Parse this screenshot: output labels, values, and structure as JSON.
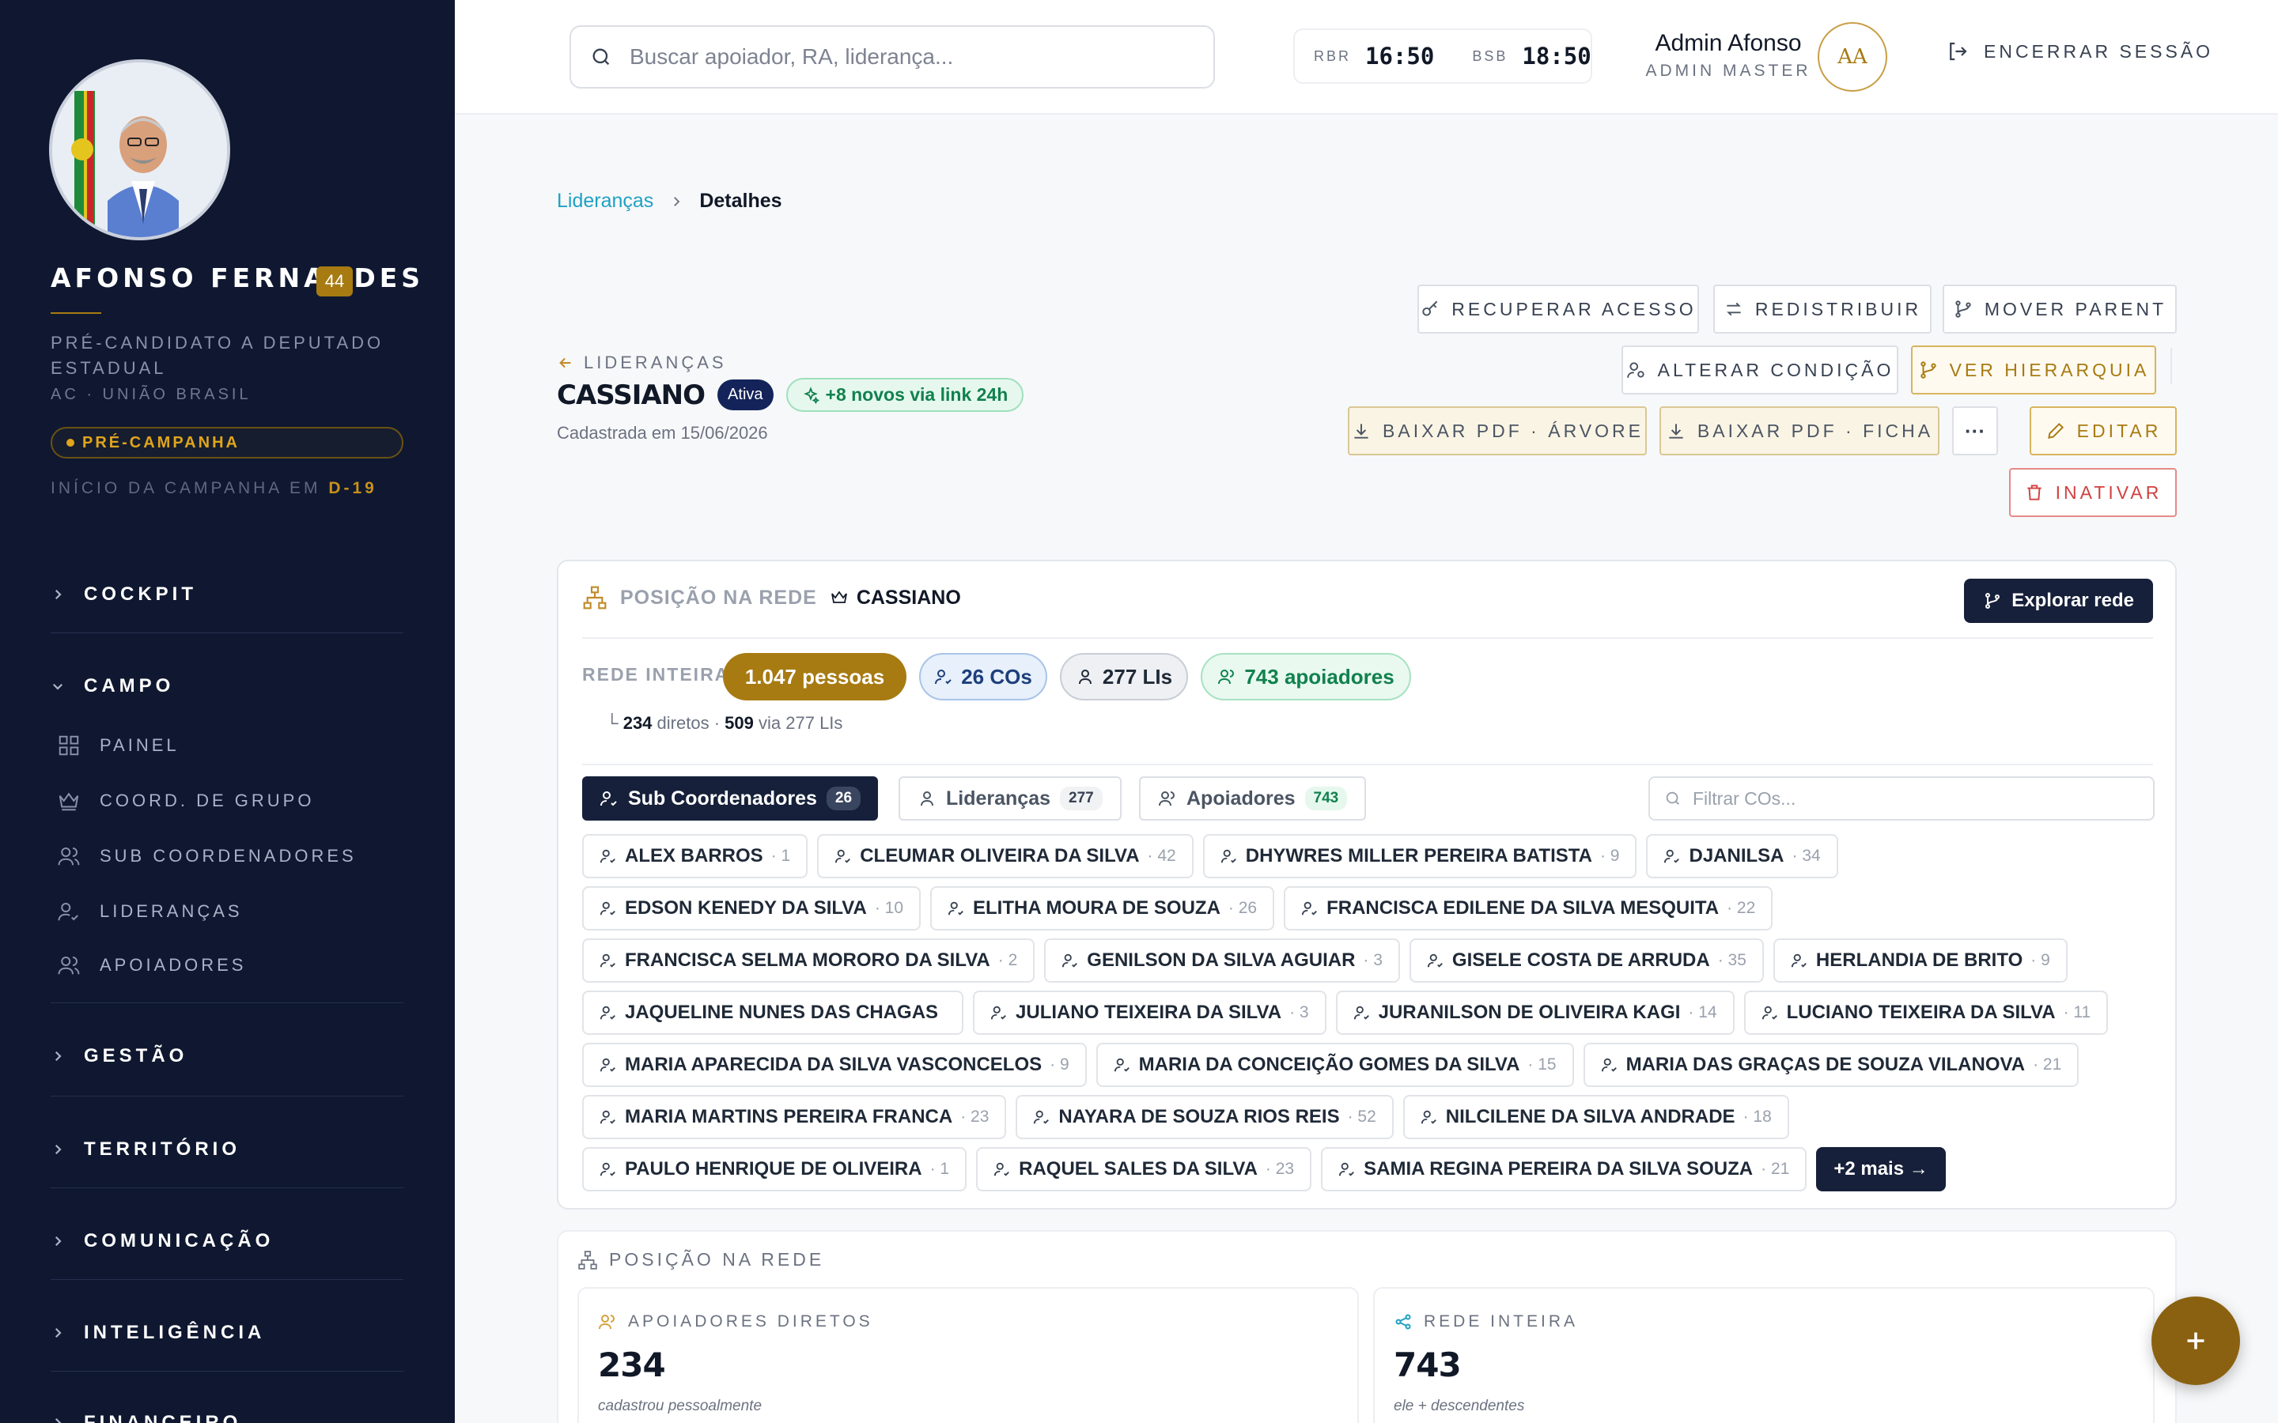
{
  "sidebar": {
    "candidate_name": "AFONSO FERNANDES",
    "candidate_number": "44",
    "candidate_role": "PRÉ-CANDIDATO A DEPUTADO ESTADUAL",
    "candidate_party": "AC · UNIÃO BRASIL",
    "phase_badge": "PRÉ-CAMPANHA",
    "campaign_start_prefix": "INÍCIO DA CAMPANHA EM",
    "campaign_start_value": "D-19",
    "sections": {
      "cockpit": "COCKPIT",
      "campo": "CAMPO",
      "gestao": "GESTÃO",
      "territorio": "TERRITÓRIO",
      "comunicacao": "COMUNICAÇÃO",
      "inteligencia": "INTELIGÊNCIA",
      "financeiro": "FINANCEIRO"
    },
    "campo_items": [
      "PAINEL",
      "COORD. DE GRUPO",
      "SUB COORDENADORES",
      "LIDERANÇAS",
      "APOIADORES"
    ]
  },
  "topbar": {
    "search_placeholder": "Buscar apoiador, RA, liderança...",
    "clock1_city": "RBR",
    "clock1_time": "16:50",
    "clock2_city": "BSB",
    "clock2_time": "18:50",
    "user_name": "Admin Afonso",
    "user_role": "ADMIN MASTER",
    "user_initials": "AA",
    "logout_label": "ENCERRAR SESSÃO"
  },
  "breadcrumb": {
    "parent": "Lideranças",
    "current": "Detalhes"
  },
  "header": {
    "back_label": "LIDERANÇAS",
    "name": "CASSIANO",
    "status": "Ativa",
    "new_badge": "+8 novos via link 24h",
    "created_label": "Cadastrada em",
    "created_date": "15/06/2026"
  },
  "actions": {
    "recover": "RECUPERAR ACESSO",
    "redistribute": "REDISTRIBUIR",
    "move_parent": "MOVER PARENT",
    "change_condition": "ALTERAR CONDIÇÃO",
    "view_hierarchy": "VER HIERARQUIA",
    "pdf_tree": "BAIXAR PDF · ÁRVORE",
    "pdf_sheet": "BAIXAR PDF · FICHA",
    "more": "···",
    "edit": "EDITAR",
    "inactivate": "INATIVAR"
  },
  "network": {
    "title": "POSIÇÃO NA REDE",
    "owner": "CASSIANO",
    "explore_label": "Explorar rede",
    "rede_label": "REDE INTEIRA",
    "total_people": "1.047 pessoas",
    "cos": "26 COs",
    "lis": "277 LIs",
    "supporters": "743 apoiadores",
    "direct_count": "234",
    "direct_label": "diretos",
    "via_count": "509",
    "via_label": "via 277 LIs",
    "tabs": [
      {
        "label": "Sub Coordenadores",
        "count": "26"
      },
      {
        "label": "Lideranças",
        "count": "277"
      },
      {
        "label": "Apoiadores",
        "count": "743"
      }
    ],
    "filter_placeholder": "Filtrar COs...",
    "coordinators": [
      {
        "name": "ALEX BARROS",
        "n": "· 1"
      },
      {
        "name": "CLEUMAR OLIVEIRA DA SILVA",
        "n": "· 42"
      },
      {
        "name": "DHYWRES MILLER PEREIRA BATISTA",
        "n": "· 9"
      },
      {
        "name": "DJANILSA",
        "n": "· 34"
      },
      {
        "name": "EDSON KENEDY DA SILVA",
        "n": "· 10"
      },
      {
        "name": "ELITHA MOURA DE SOUZA",
        "n": "· 26"
      },
      {
        "name": "FRANCISCA EDILENE DA SILVA MESQUITA",
        "n": "· 22"
      },
      {
        "name": "FRANCISCA SELMA MORORO DA SILVA",
        "n": "· 2"
      },
      {
        "name": "GENILSON DA SILVA AGUIAR",
        "n": "· 3"
      },
      {
        "name": "GISELE COSTA DE ARRUDA",
        "n": "· 35"
      },
      {
        "name": "HERLANDIA DE BRITO",
        "n": "· 9"
      },
      {
        "name": "JAQUELINE NUNES DAS CHAGAS",
        "n": ""
      },
      {
        "name": "JULIANO TEIXEIRA DA SILVA",
        "n": "· 3"
      },
      {
        "name": "JURANILSON DE OLIVEIRA KAGI",
        "n": "· 14"
      },
      {
        "name": "LUCIANO TEIXEIRA DA SILVA",
        "n": "· 11"
      },
      {
        "name": "MARIA APARECIDA DA SILVA VASCONCELOS",
        "n": "· 9"
      },
      {
        "name": "MARIA DA CONCEIÇÃO GOMES DA SILVA",
        "n": "· 15"
      },
      {
        "name": "MARIA DAS GRAÇAS DE SOUZA VILANOVA",
        "n": "· 21"
      },
      {
        "name": "MARIA MARTINS PEREIRA FRANCA",
        "n": "· 23"
      },
      {
        "name": "NAYARA DE SOUZA RIOS REIS",
        "n": "· 52"
      },
      {
        "name": "NILCILENE DA SILVA ANDRADE",
        "n": "· 18"
      },
      {
        "name": "PAULO HENRIQUE DE OLIVEIRA",
        "n": "· 1"
      },
      {
        "name": "RAQUEL SALES DA SILVA",
        "n": "· 23"
      },
      {
        "name": "SAMIA REGINA PEREIRA DA SILVA SOUZA",
        "n": "· 21"
      }
    ],
    "more_label": "+2 mais →"
  },
  "position": {
    "title": "POSIÇÃO NA REDE",
    "direct_title": "APOIADORES DIRETOS",
    "direct_value": "234",
    "direct_caption": "cadastrou pessoalmente",
    "network_title": "REDE INTEIRA",
    "network_value": "743",
    "network_caption": "ele + descendentes"
  },
  "colors": {
    "sidebar_bg": "#0f1830",
    "gold": "#a77b12",
    "navy": "#16203a",
    "teal_link": "#1ea2c4",
    "green": "#11814d",
    "red": "#d14141"
  }
}
